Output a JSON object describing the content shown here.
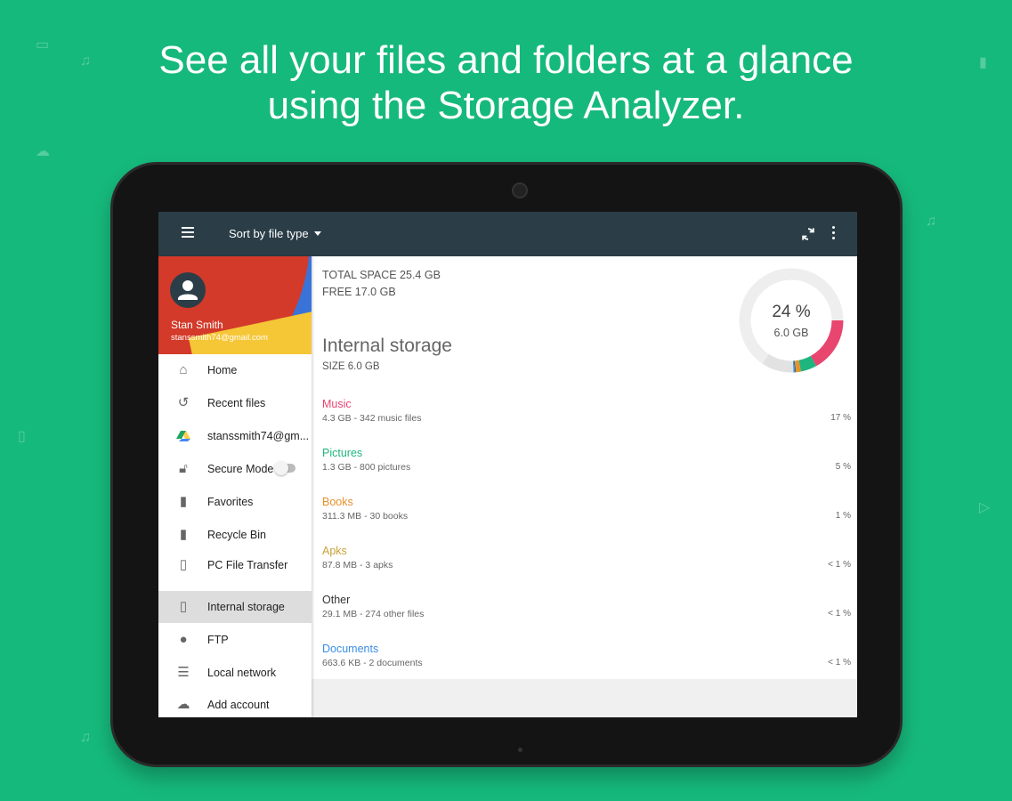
{
  "headline": {
    "line1": "See all your files and folders at a glance",
    "line2": "using the Storage Analyzer."
  },
  "toolbar": {
    "menu_icon": "hamburger-icon",
    "sort_label": "Sort by file type",
    "refresh_icon": "refresh-icon",
    "more_icon": "more-vert-icon"
  },
  "sidebar": {
    "user": {
      "name": "Stan Smith",
      "email": "stanssmith74@gmail.com"
    },
    "items": [
      {
        "label": "Home",
        "icon": "home-icon"
      },
      {
        "label": "Recent files",
        "icon": "history-icon"
      },
      {
        "label": "stanssmith74@gm...",
        "icon": "google-drive-icon"
      },
      {
        "label": "Secure Mode",
        "icon": "lock-open-icon",
        "toggle": false
      },
      {
        "label": "Favorites",
        "icon": "bookmark-icon"
      },
      {
        "label": "Recycle Bin",
        "icon": "trash-icon"
      },
      {
        "label": "PC File Transfer",
        "icon": "phone-transfer-icon"
      },
      {
        "label": "Internal storage",
        "icon": "phone-icon",
        "selected": true
      },
      {
        "label": "FTP",
        "icon": "globe-icon"
      },
      {
        "label": "Local network",
        "icon": "server-icon"
      },
      {
        "label": "Add account",
        "icon": "cloud-add-icon"
      }
    ]
  },
  "storage": {
    "total": "TOTAL SPACE 25.4 GB",
    "free": "FREE 17.0 GB",
    "title": "Internal storage",
    "size": "SIZE 6.0 GB",
    "used_percent": "24 %",
    "used_size": "6.0 GB"
  },
  "categories": [
    {
      "name": "Music",
      "detail": "4.3 GB - 342 music files",
      "percent": "17 %",
      "color": "#e8456f",
      "share": 17
    },
    {
      "name": "Pictures",
      "detail": "1.3 GB - 800 pictures",
      "percent": "5 %",
      "color": "#1fb57f",
      "share": 5
    },
    {
      "name": "Books",
      "detail": "311.3 MB - 30 books",
      "percent": "1 %",
      "color": "#e8902a",
      "share": 1.2
    },
    {
      "name": "Apks",
      "detail": "87.8 MB - 3 apks",
      "percent": "< 1 %",
      "color": "#c9a23a",
      "share": 0.4
    },
    {
      "name": "Other",
      "detail": "29.1 MB - 274 other files",
      "percent": "< 1 %",
      "color": "#333333",
      "share": 0.2
    },
    {
      "name": "Documents",
      "detail": "663.6 KB - 2 documents",
      "percent": "< 1 %",
      "color": "#3a8ee6",
      "share": 0.5
    }
  ],
  "colors": {
    "background": "#16b97c",
    "toolbar": "#2b3e48",
    "donut_track": "#eeeeee",
    "donut_system": "#e2e2e2"
  }
}
